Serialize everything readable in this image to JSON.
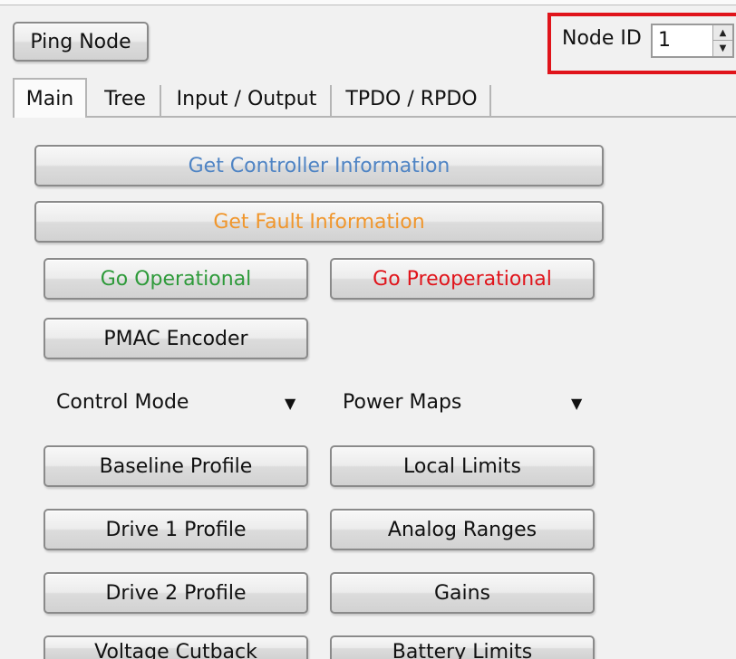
{
  "toolbar": {
    "ping_label": "Ping Node"
  },
  "node": {
    "label": "Node ID",
    "value": "1"
  },
  "tabs": [
    {
      "label": "Main"
    },
    {
      "label": "Tree"
    },
    {
      "label": "Input / Output"
    },
    {
      "label": "TPDO / RPDO"
    }
  ],
  "main": {
    "get_controller_info": "Get Controller Information",
    "get_fault_info": "Get Fault Information",
    "go_operational": "Go Operational",
    "go_preoperational": "Go Preoperational",
    "pmac_encoder": "PMAC Encoder",
    "control_mode": "Control Mode",
    "power_maps": "Power Maps",
    "baseline_profile": "Baseline Profile",
    "local_limits": "Local Limits",
    "drive1_profile": "Drive 1 Profile",
    "analog_ranges": "Analog Ranges",
    "drive2_profile": "Drive 2 Profile",
    "gains": "Gains",
    "voltage_cutback": "Voltage Cutback",
    "battery_limits": "Battery Limits"
  },
  "colors": {
    "controller_info_text": "#4f84c4",
    "fault_info_text": "#f0962c",
    "operational_text": "#2e9a3a",
    "preoperational_text": "#e0141b",
    "highlight_border": "#e0141b"
  }
}
